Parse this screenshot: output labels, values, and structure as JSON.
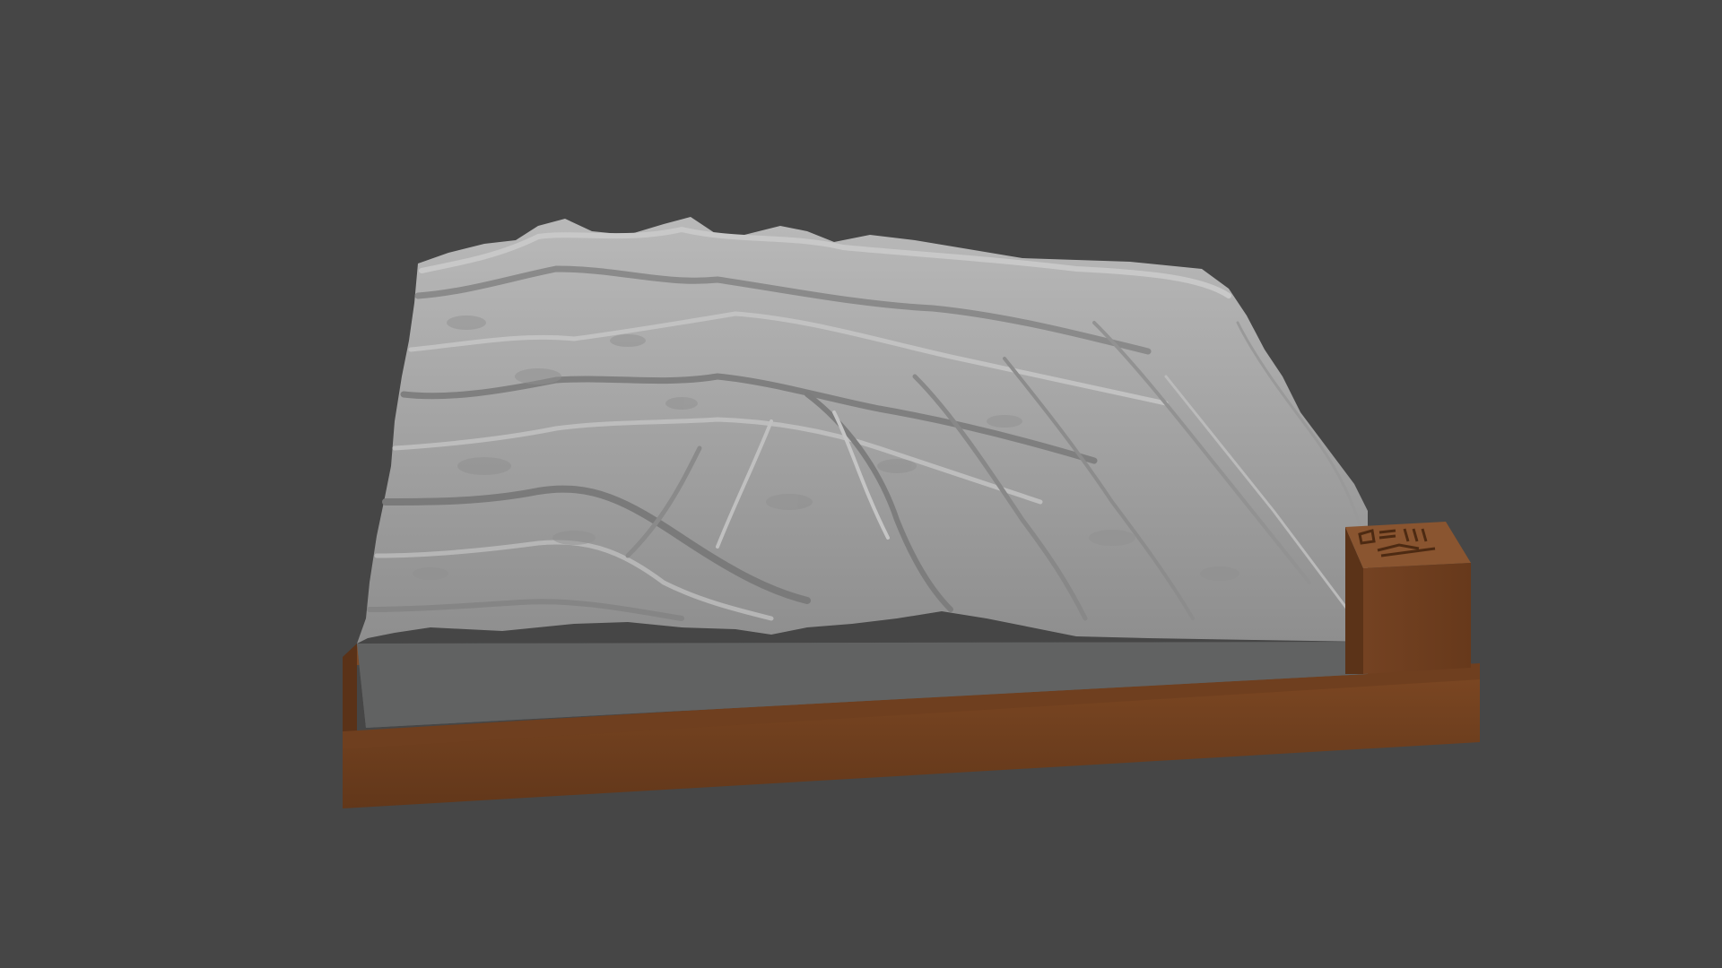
{
  "viewport": {
    "background_color": "#464646"
  },
  "model": {
    "terrain_color": "#a7a7a7",
    "terrain_shadow_color": "#6e6e6e",
    "terrain_highlight_color": "#c9c9c9",
    "terrain_side_color": "#5d5e5e",
    "base_color": "#6b3e1f",
    "base_top_color": "#7a4824",
    "base_shadow_color": "#4f2d16"
  }
}
